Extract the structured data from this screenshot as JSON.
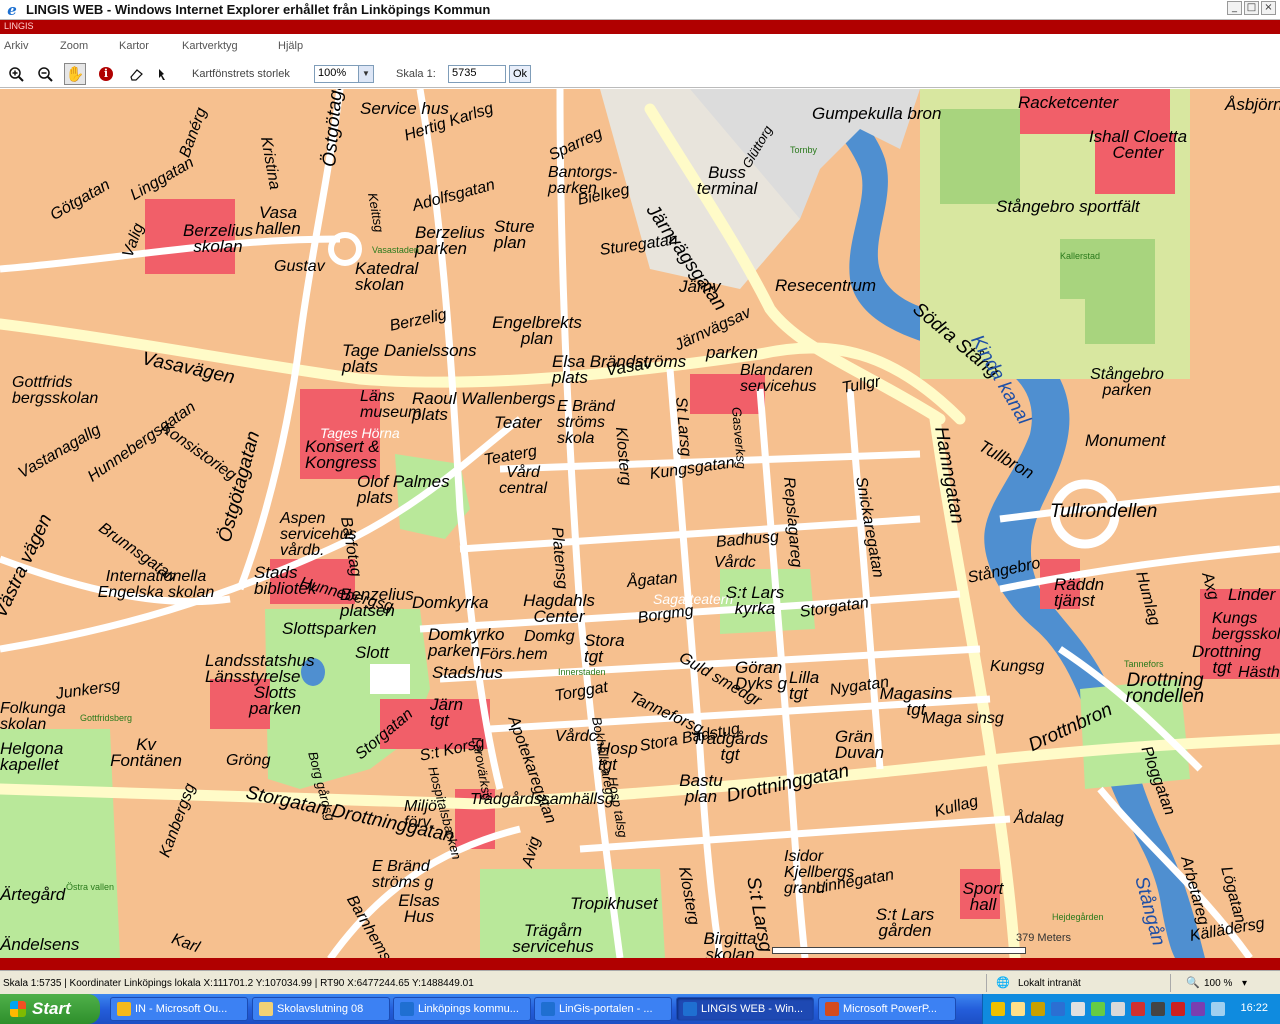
{
  "window": {
    "title": "LINGIS WEB - Windows Internet Explorer erhållet från Linköpings Kommun",
    "app_strip": "LINGIS"
  },
  "menu": [
    "Arkiv",
    "Zoom",
    "Kartor",
    "Kartverktyg",
    "Hjälp"
  ],
  "toolbar": {
    "tools": [
      {
        "name": "zoom-in-icon",
        "glyph": "⊕"
      },
      {
        "name": "zoom-out-icon",
        "glyph": "⊖"
      },
      {
        "name": "pan-hand-icon",
        "glyph": "✋"
      },
      {
        "name": "info-icon",
        "glyph": "i"
      },
      {
        "name": "eraser-icon",
        "glyph": "◇"
      },
      {
        "name": "pointer-icon",
        "glyph": "✎"
      }
    ],
    "window_size_label": "Kartfönstrets storlek",
    "window_size_value": "100%",
    "scale_label": "Skala 1:",
    "scale_value": "5735",
    "ok_label": "Ok"
  },
  "map": {
    "scale_text": "379 Meters",
    "colors": {
      "block": "#f6c08f",
      "building": "#f3a47a",
      "public_building": "#f15f69",
      "park": "#b9e89a",
      "water": "#4f8fd0",
      "road": "#ffffff",
      "main_road": "#fffbc8"
    },
    "labels": [
      "Service hus",
      "Hertig Karlsg",
      "Gumpekulla bron",
      "Racketcenter",
      "Åsbjörn",
      "Ishall Cloetta Center",
      "Sparreg",
      "Bantorgs- parken",
      "Bielkeg",
      "Buss terminal",
      "Glüttorg",
      "Tornby",
      "Banérg",
      "Kristina",
      "Östgötagatan",
      "Adolfsgatan",
      "Berzelius parken",
      "Götgatan",
      "Linggatan",
      "Berzelius skolan",
      "Vasa hallen",
      "Valig",
      "Gustav",
      "Keittsg",
      "Sture plan",
      "Sturegatan",
      "Järnvägsgatan",
      "Stångebro sportfält",
      "Vasastaden",
      "Katedral skolan",
      "Kallerstad",
      "Järnv",
      "Resecentrum",
      "Södra Stång",
      "Kinda kanal",
      "Berzelig",
      "Engelbrekts plan",
      "Tage Danielssons plats",
      "Vasavägen",
      "Elsa Brändströms plats",
      "Järnvägsav",
      "parken",
      "Blandaren servicehus",
      "Gottfrids bergsskolan",
      "Läns museum",
      "Raoul Wallenbergs plats",
      "E Bränd ströms skola",
      "Tullgr",
      "Stångebro parken",
      "Konsistorieg",
      "Hunnebergsgatan",
      "Tages Hörna",
      "Konsert & Kongress",
      "Teater",
      "Teaterg",
      "Vård central",
      "St Larsg",
      "Gasverksg",
      "Kungsgatan",
      "Hamngatan",
      "Monument",
      "Tullbron",
      "Vasav",
      "Vastanagallg",
      "Olof Palmes plats",
      "Klosterg",
      "Repslagareg",
      "Snickaregatan",
      "Tullrondellen",
      "Brunnsgatan",
      "Aspen servicehus vårdb.",
      "Barfotag",
      "Platensg",
      "Badhusg",
      "Vårdc",
      "Stångebro",
      "Internationella Engelska skolan",
      "Stads bibliotek",
      "Hunnebergsg",
      "Östgötagatan",
      "Ågatan",
      "Saga teatern",
      "S:t Lars kyrka",
      "Räddn tjänst",
      "Humlag",
      "Axg",
      "Linder",
      "Västra vägen",
      "Benzelius platsen",
      "Domkyrka",
      "Hagdahls Center",
      "Borgmg",
      "Storgatan",
      "Kungs bergsskolan",
      "Slottsparken",
      "Domkyrko parken",
      "Domkg",
      "Stora tgt",
      "Förs.hem",
      "Drottning tgt",
      "Slott",
      "Landsstatshus Länsstyrelse",
      "Stadshus",
      "Innerstaden",
      "Guld smedgr",
      "Göran Dyks g",
      "Lilla tgt",
      "Tannefors",
      "Nygatan",
      "Magasins tgt",
      "Maga sinsg",
      "Drottning rondellen",
      "Kungsg",
      "Junkersg",
      "Slotts parken",
      "Järn tgt",
      "Folkunga skolan",
      "Gottfridsberg",
      "Torggat",
      "Tanneforsg",
      "Bokhålls areg",
      "Apotekaregatan",
      "Vårdc",
      "Trädgårds tgt",
      "Grän Duvan",
      "Drottnbron",
      "Kv Fontänen",
      "Gröng",
      "Borg gårdsg",
      "Storgatan",
      "S:t Korsg",
      "Hospitalsbacken",
      "Lärovärksg",
      "Hosp tgt",
      "Stora Badstug",
      "Bastu plan",
      "Hosp talsg",
      "Storgatan Drottninggatan",
      "Miljö förv.",
      "Trädgårdssamhällsg",
      "Drottninggatan",
      "Kullag",
      "Ådalag",
      "Ploggatan",
      "Kanbergsg",
      "Isidor Kjellbergs grand",
      "E Bränd ströms g",
      "Elsas Hus",
      "Avig",
      "Tropikhuset",
      "Klosterg",
      "S:t Larsg",
      "Linnégatan",
      "Sport hall",
      "S:t Lars gården",
      "Hejdegården",
      "Trägårn servicehus",
      "Birgitta skolan",
      "Barnhemsg",
      "Ärtegård",
      "Östra vallen",
      "Ändelsens",
      "Karl",
      "Stångån",
      "Källädersg",
      "Lögatan",
      "Arbetareg",
      "Helgona kapellet",
      "Hästh"
    ]
  },
  "statusbar": {
    "coords": "Skala 1:5735 | Koordinater Linköpings lokala X:111701.2 Y:107034.99 | RT90 X:6477244.65 Y:1488449.01",
    "zone": "Lokalt intranät",
    "zoom": "100 %"
  },
  "taskbar": {
    "start_label": "Start",
    "tasks": [
      {
        "label": "IN - Microsoft Ou...",
        "color": "#f5b91c",
        "active": false
      },
      {
        "label": "Skolavslutning 08",
        "color": "#f1d176",
        "active": false
      },
      {
        "label": "Linköpings kommu...",
        "color": "#1f6fd1",
        "active": false
      },
      {
        "label": "LinGis-portalen - ...",
        "color": "#1f6fd1",
        "active": false
      },
      {
        "label": "LINGIS WEB - Win...",
        "color": "#1f6fd1",
        "active": true
      },
      {
        "label": "Microsoft PowerP...",
        "color": "#d34b1f",
        "active": false
      }
    ],
    "clock": "16:22"
  }
}
